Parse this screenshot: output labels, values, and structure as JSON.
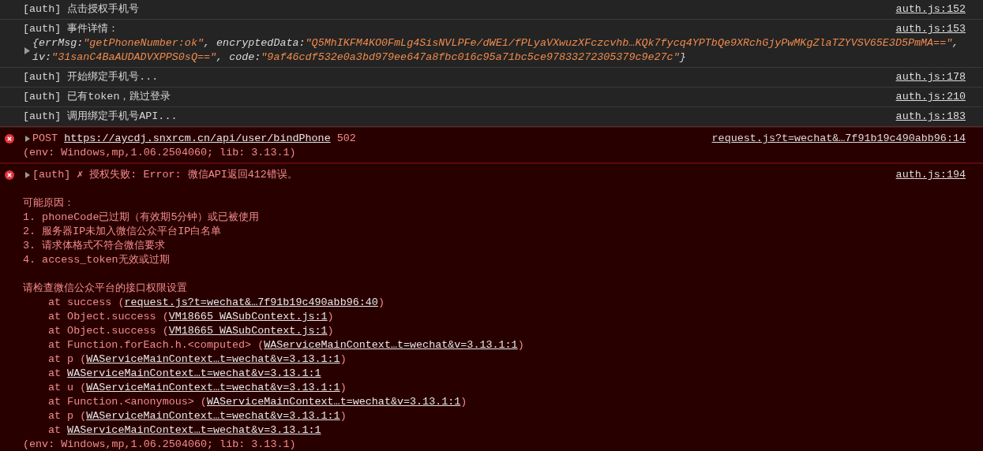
{
  "entries": [
    {
      "kind": "log",
      "text": "[auth] 点击授权手机号",
      "source": "auth.js:152"
    },
    {
      "kind": "log",
      "text": "[auth] 事件详情：",
      "source": "auth.js:153",
      "object": {
        "open": "{",
        "close": "}",
        "separator": ", ",
        "props": [
          {
            "key": "errMsg:",
            "value": "\"getPhoneNumber:ok\""
          },
          {
            "key": "encryptedData:",
            "value": "\"Q5MhIKFM4KO0FmLg4SisNVLPFe/dWE1/fPLyaVXwuzXFczcvhb…KQk7fycq4YPTbQe9XRchGjyPwMKgZlaTZYVSV65E3D5PmMA==\""
          },
          {
            "key": "iv:",
            "value": "\"31sanC4BaAUDADVXPPS0sQ==\""
          },
          {
            "key": "code:",
            "value": "\"9af46cdf532e0a3bd979ee647a8fbc016c95a71bc5ce97833272305379c9e27c\""
          }
        ]
      }
    },
    {
      "kind": "log",
      "text": "[auth] 开始绑定手机号...",
      "source": "auth.js:178"
    },
    {
      "kind": "log",
      "text": "[auth] 已有token，跳过登录",
      "source": "auth.js:210"
    },
    {
      "kind": "log",
      "text": "[auth] 调用绑定手机号API...",
      "source": "auth.js:183"
    },
    {
      "kind": "request",
      "method": "POST",
      "url": "https://aycdj.snxrcm.cn/api/user/bindPhone",
      "status": "502",
      "source": "request.js?t=wechat&…7f91b19c490abb96:14",
      "env": "(env: Windows,mp,1.06.2504060; lib: 3.13.1)"
    },
    {
      "kind": "exception",
      "text": "[auth] ✗ 授权失败: Error: 微信API返回412错误。",
      "source": "auth.js:194",
      "paragraphs": [
        [
          "可能原因：",
          "1. phoneCode已过期（有效期5分钟）或已被使用",
          "2. 服务器IP未加入微信公众平台IP白名单",
          "3. 请求体格式不符合微信要求",
          "4. access_token无效或过期"
        ],
        [
          "请检查微信公众平台的接口权限设置"
        ]
      ],
      "stack": [
        {
          "text": "at success (",
          "link": "request.js?t=wechat&…7f91b19c490abb96:40",
          "close": ")"
        },
        {
          "text": "at Object.success (",
          "link": "VM18665 WASubContext.js:1",
          "close": ")"
        },
        {
          "text": "at Object.success (",
          "link": "VM18665 WASubContext.js:1",
          "close": ")"
        },
        {
          "text": "at Function.forEach.h.<computed> (",
          "link": "WAServiceMainContext…t=wechat&v=3.13.1:1",
          "close": ")"
        },
        {
          "text": "at p (",
          "link": "WAServiceMainContext…t=wechat&v=3.13.1:1",
          "close": ")"
        },
        {
          "text": "at ",
          "link": "WAServiceMainContext…t=wechat&v=3.13.1:1"
        },
        {
          "text": "at u (",
          "link": "WAServiceMainContext…t=wechat&v=3.13.1:1",
          "close": ")"
        },
        {
          "text": "at Function.<anonymous> (",
          "link": "WAServiceMainContext…t=wechat&v=3.13.1:1",
          "close": ")"
        },
        {
          "text": "at p (",
          "link": "WAServiceMainContext…t=wechat&v=3.13.1:1",
          "close": ")"
        },
        {
          "text": "at ",
          "link": "WAServiceMainContext…t=wechat&v=3.13.1:1"
        }
      ],
      "env": "(env: Windows,mp,1.06.2504060; lib: 3.13.1)"
    }
  ]
}
